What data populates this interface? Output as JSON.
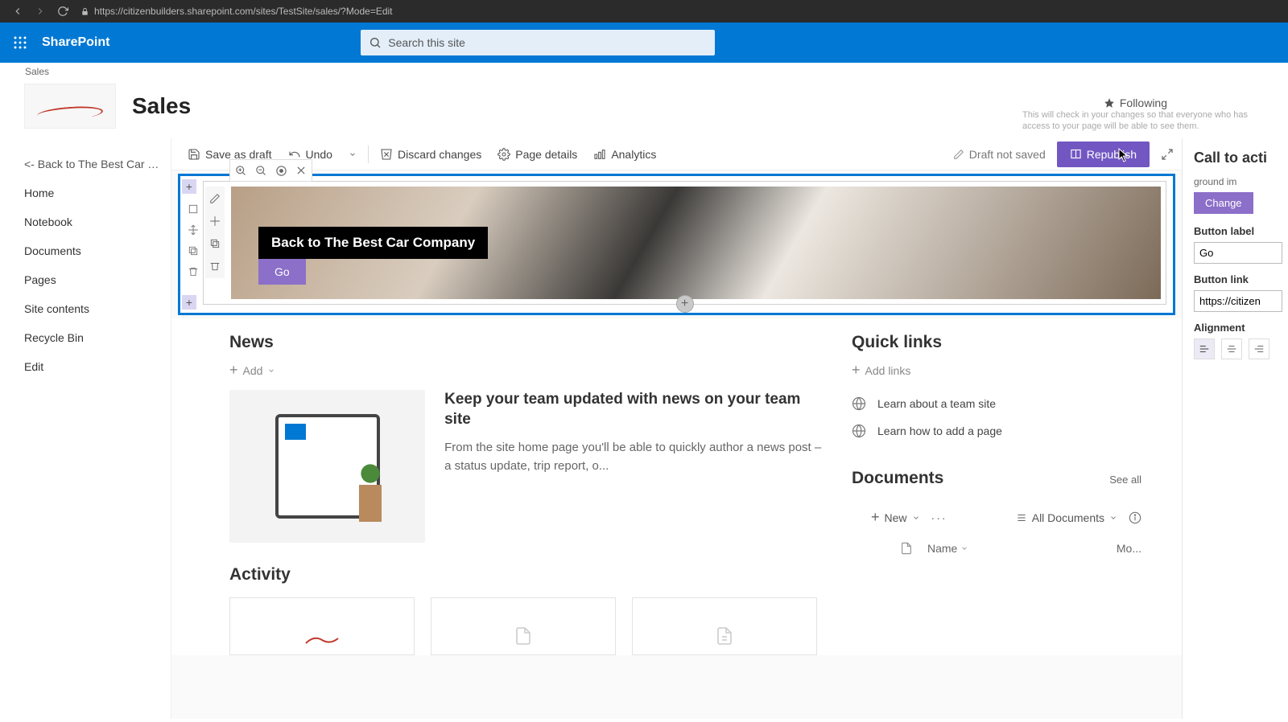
{
  "browser": {
    "url": "https://citizenbuilders.sharepoint.com/sites/TestSite/sales/?Mode=Edit"
  },
  "suite": {
    "brand": "SharePoint",
    "search_placeholder": "Search this site"
  },
  "breadcrumb": "Sales",
  "site": {
    "title": "Sales",
    "follow_label": "Following",
    "tooltip": "This will check in your changes so that everyone who has access to your page will be able to see them."
  },
  "leftnav": {
    "back": "<- Back to The Best Car C...",
    "items": [
      "Home",
      "Notebook",
      "Documents",
      "Pages",
      "Site contents",
      "Recycle Bin",
      "Edit"
    ]
  },
  "cmdbar": {
    "save": "Save as draft",
    "undo": "Undo",
    "discard": "Discard changes",
    "details": "Page details",
    "analytics": "Analytics",
    "status": "Draft not saved",
    "republish": "Republish"
  },
  "hero": {
    "title": "Back to The Best Car Company",
    "button": "Go"
  },
  "news": {
    "heading": "News",
    "add": "Add",
    "headline": "Keep your team updated with news on your team site",
    "body": "From the site home page you'll be able to quickly author a news post – a status update, trip report, o..."
  },
  "quicklinks": {
    "heading": "Quick links",
    "add": "Add links",
    "items": [
      "Learn about a team site",
      "Learn how to add a page"
    ]
  },
  "documents": {
    "heading": "Documents",
    "seeall": "See all",
    "new": "New",
    "view": "All Documents",
    "cols": {
      "name": "Name",
      "mod": "Mo..."
    }
  },
  "activity": {
    "heading": "Activity"
  },
  "panel": {
    "title": "Call to acti",
    "bg_label": "ground im",
    "change": "Change",
    "btn_label_lbl": "Button label",
    "btn_label_val": "Go",
    "btn_link_lbl": "Button link",
    "btn_link_val": "https://citizen",
    "align_lbl": "Alignment"
  }
}
